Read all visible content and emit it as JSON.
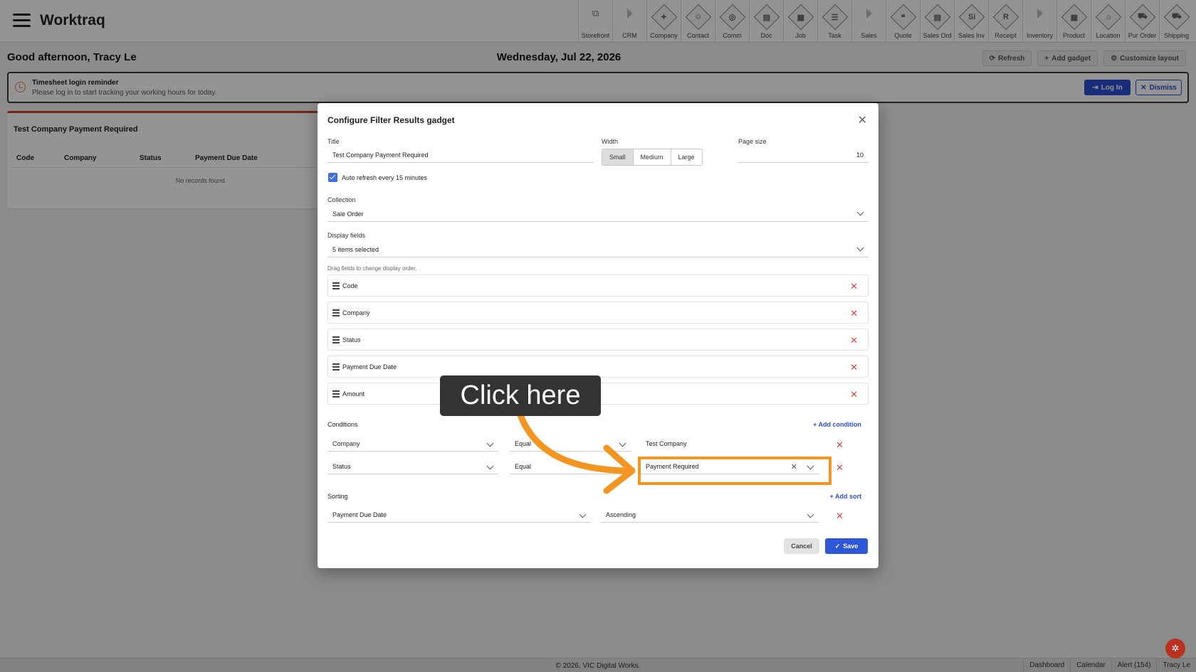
{
  "app": {
    "title": "Worktraq"
  },
  "nav": [
    {
      "label": "Storefront",
      "icon": "external-link-icon",
      "kind": "ext"
    },
    {
      "label": "CRM",
      "icon": "caret-right-icon",
      "kind": "arrow"
    },
    {
      "label": "Company",
      "icon": "company-icon",
      "kind": "diamond",
      "glyph": "✦"
    },
    {
      "label": "Contact",
      "icon": "contact-icon",
      "kind": "diamond",
      "glyph": "☺"
    },
    {
      "label": "Comm",
      "icon": "comm-icon",
      "kind": "diamond",
      "glyph": "◎"
    },
    {
      "label": "Doc",
      "icon": "doc-icon",
      "kind": "diamond",
      "glyph": "▤"
    },
    {
      "label": "Job",
      "icon": "job-icon",
      "kind": "diamond",
      "glyph": "▦"
    },
    {
      "label": "Task",
      "icon": "task-icon",
      "kind": "diamond",
      "glyph": "☰"
    },
    {
      "label": "Sales",
      "icon": "caret-right-icon",
      "kind": "arrow"
    },
    {
      "label": "Quote",
      "icon": "quote-icon",
      "kind": "diamond",
      "glyph": "❝"
    },
    {
      "label": "Sales Ord",
      "icon": "sales-order-icon",
      "kind": "diamond",
      "glyph": "▤"
    },
    {
      "label": "Sales Inv",
      "icon": "sales-invoice-icon",
      "kind": "diamond",
      "glyph": "Si"
    },
    {
      "label": "Receipt",
      "icon": "receipt-icon",
      "kind": "diamond",
      "glyph": "R"
    },
    {
      "label": "Inventory",
      "icon": "caret-right-icon",
      "kind": "arrow"
    },
    {
      "label": "Product",
      "icon": "product-icon",
      "kind": "diamond",
      "glyph": "▦"
    },
    {
      "label": "Location",
      "icon": "location-icon",
      "kind": "diamond",
      "glyph": "⌂"
    },
    {
      "label": "Pur Order",
      "icon": "purchase-order-icon",
      "kind": "diamond",
      "glyph": "⛟"
    },
    {
      "label": "Shipping",
      "icon": "shipping-icon",
      "kind": "diamond",
      "glyph": "⛟"
    }
  ],
  "header": {
    "greeting": "Good afternoon, Tracy Le",
    "date": "Wednesday, Jul 22, 2026",
    "refresh": "Refresh",
    "add_gadget": "Add gadget",
    "customize": "Customize layout"
  },
  "reminder": {
    "title": "Timesheet login reminder",
    "message": "Please log in to start tracking your working hours for today.",
    "login": "Log In",
    "dismiss": "Dismiss"
  },
  "gadget": {
    "title": "Test Company Payment Required",
    "columns": [
      "Code",
      "Company",
      "Status",
      "Payment Due Date"
    ],
    "empty": "No records found."
  },
  "modal": {
    "title": "Configure Filter Results gadget",
    "title_label": "Title",
    "title_value": "Test Company Payment Required",
    "width_label": "Width",
    "width_options": [
      "Small",
      "Medium",
      "Large"
    ],
    "width_selected": "Small",
    "page_size_label": "Page size",
    "page_size_value": "10",
    "auto_refresh": "Auto refresh every 15 minutes",
    "collection_label": "Collection",
    "collection_value": "Sale Order",
    "display_fields_label": "Display fields",
    "display_fields_value": "5 items selected",
    "drag_hint": "Drag fields to change display order.",
    "fields": [
      "Code",
      "Company",
      "Status",
      "Payment Due Date",
      "Amount"
    ],
    "conditions_label": "Conditions",
    "add_condition": "Add condition",
    "conditions": [
      {
        "field": "Company",
        "operator": "Equal",
        "value": "Test Company"
      },
      {
        "field": "Status",
        "operator": "Equal",
        "value": "Payment Required"
      }
    ],
    "sorting_label": "Sorting",
    "add_sort": "Add sort",
    "sort": {
      "field": "Payment Due Date",
      "direction": "Ascending"
    },
    "cancel": "Cancel",
    "save": "Save"
  },
  "callout": {
    "text": "Click here",
    "color": "#f39521"
  },
  "footer": {
    "copyright": "© 2026, VIC Digital Works.",
    "links": [
      "Dashboard",
      "Calendar",
      "Alert (154)",
      "Tracy Le"
    ]
  }
}
